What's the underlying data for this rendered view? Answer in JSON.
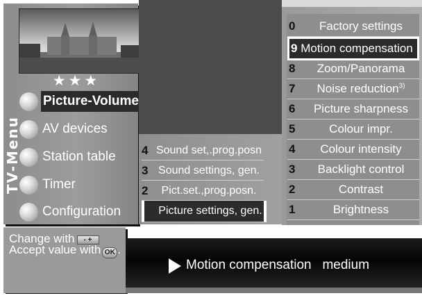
{
  "menu": {
    "vertical_title": "TV-Menu",
    "stars": "★★★",
    "items": [
      {
        "label": "Picture-Volume",
        "active": true
      },
      {
        "label": "AV devices"
      },
      {
        "label": "Station table"
      },
      {
        "label": "Timer"
      },
      {
        "label": "Configuration"
      }
    ]
  },
  "help": {
    "change_with": "Change with",
    "minus_plus": "- +",
    "accept_with": "Accept value with",
    "ok": "OK"
  },
  "submenu": {
    "items": [
      {
        "num": "4",
        "label": "Sound set,.prog.posn"
      },
      {
        "num": "3",
        "label": "Sound settings, gen."
      },
      {
        "num": "2",
        "label": "Pict.set.,prog.posn."
      },
      {
        "num": "1",
        "label": "Picture settings, gen.",
        "selected": true
      }
    ]
  },
  "settings": {
    "items": [
      {
        "num": "0",
        "label": "Factory settings"
      },
      {
        "num": "9",
        "label": "Motion compensation",
        "selected": true
      },
      {
        "num": "8",
        "label": "Zoom/Panorama"
      },
      {
        "num": "7",
        "label": "Noise reduction",
        "sup": "3)"
      },
      {
        "num": "6",
        "label": "Picture sharpness"
      },
      {
        "num": "5",
        "label": "Colour impr."
      },
      {
        "num": "4",
        "label": "Colour intensity"
      },
      {
        "num": "3",
        "label": "Backlight control"
      },
      {
        "num": "2",
        "label": "Contrast"
      },
      {
        "num": "1",
        "label": "Brightness"
      }
    ]
  },
  "status": {
    "text": "Motion compensation   medium"
  }
}
